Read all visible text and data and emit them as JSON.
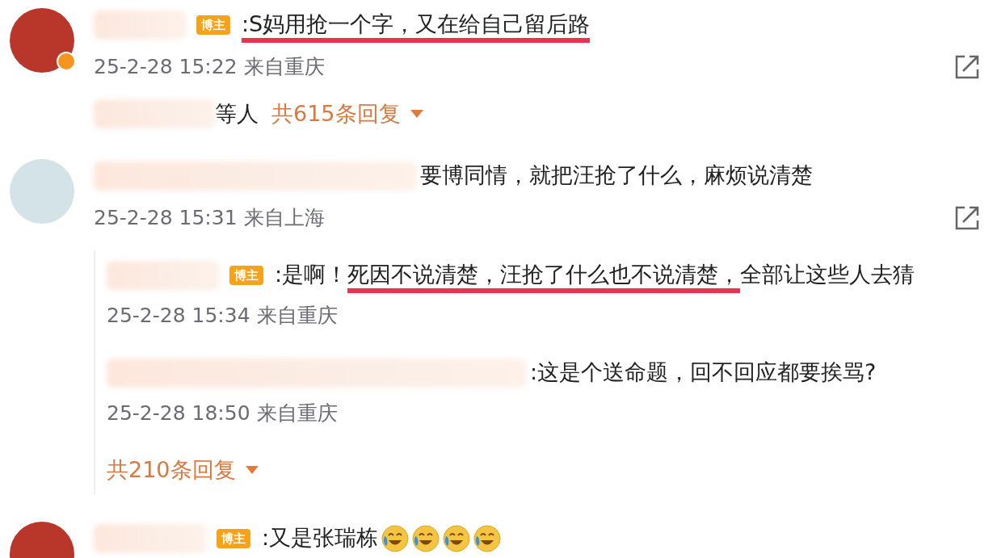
{
  "comments": [
    {
      "color": "#b8362a",
      "verified": true,
      "badge": "博主",
      "segments": [
        {
          "text": ":S妈用抢一个字，又在给自己留后路",
          "underlined": true
        }
      ],
      "time": "25-2-28 15:22 来自重庆",
      "share": true,
      "reply_summary": {
        "suffix": "等人",
        "count": "共615条回复"
      }
    },
    {
      "color": "#d3e3e8",
      "verified": false,
      "segments": [
        {
          "text": "要博同情，就把汪抢了什么，麻烦说清楚",
          "underlined": false
        }
      ],
      "time": "25-2-28 15:31 来自上海",
      "share": true,
      "replies": [
        {
          "badge": "博主",
          "segments": [
            {
              "text": ":是啊！",
              "underlined": false
            },
            {
              "text": "死因不说清楚，汪抢了什么也不说清楚，",
              "underlined": true
            },
            {
              "text": "全部让这些人去猜",
              "underlined": false
            }
          ],
          "time": "25-2-28 15:34 来自重庆"
        },
        {
          "segments": [
            {
              "text": ":这是个送命题，回不回应都要挨骂?",
              "underlined": false
            }
          ],
          "time": "25-2-28 18:50 来自重庆"
        }
      ],
      "more": "共210条回复"
    },
    {
      "color": "#b8362a",
      "verified": false,
      "badge": "博主",
      "segments": [
        {
          "text": ":又是张瑞栋",
          "underlined": false
        }
      ],
      "emojis": [
        {
          "kind": "laugh-cry"
        },
        {
          "kind": "laugh-cry"
        },
        {
          "kind": "laugh-cry"
        },
        {
          "kind": "laugh-cry"
        }
      ]
    }
  ]
}
